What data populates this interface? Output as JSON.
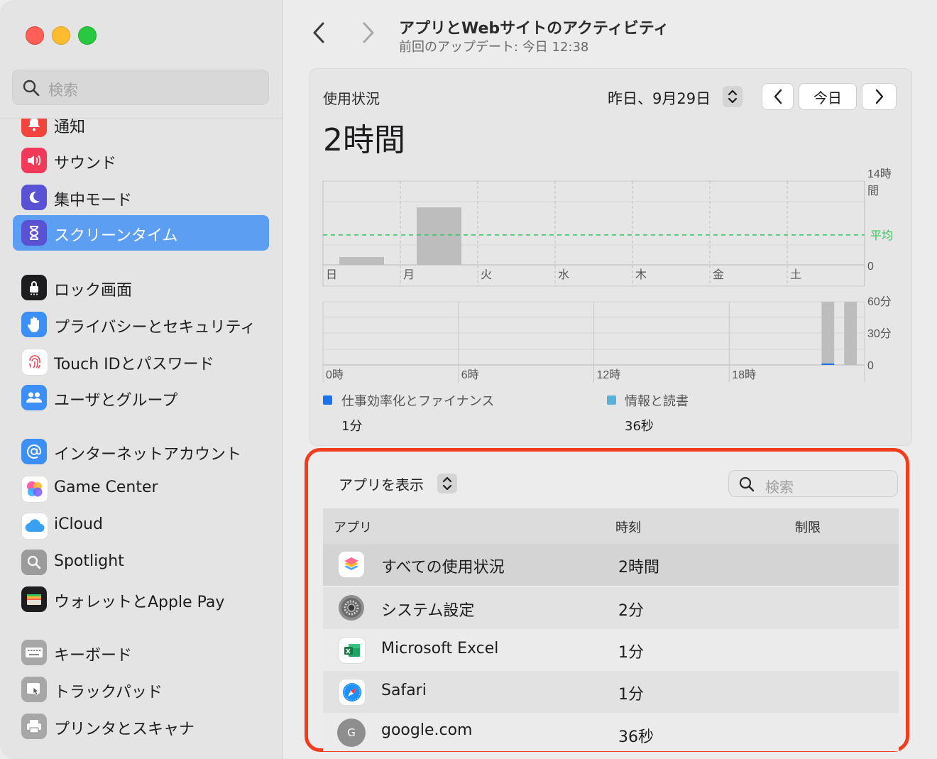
{
  "sidebar": {
    "search_placeholder": "検索",
    "items": [
      {
        "label": "通知",
        "icon": "bell-icon",
        "color": "#f2443d"
      },
      {
        "label": "サウンド",
        "icon": "speaker-icon",
        "color": "#f2395a"
      },
      {
        "label": "集中モード",
        "icon": "moon-icon",
        "color": "#5a52d4"
      },
      {
        "label": "スクリーンタイム",
        "icon": "hourglass-icon",
        "color": "#5a52d4",
        "selected": true
      },
      {
        "label": "ロック画面",
        "icon": "lock-icon",
        "color": "#1d1d1f"
      },
      {
        "label": "プライバシーとセキュリティ",
        "icon": "hand-icon",
        "color": "#3b8ff5"
      },
      {
        "label": "Touch IDとパスワード",
        "icon": "fingerprint-icon",
        "color": "#ffffff"
      },
      {
        "label": "ユーザとグループ",
        "icon": "users-icon",
        "color": "#3b8ff5"
      },
      {
        "label": "インターネットアカウント",
        "icon": "at-icon",
        "color": "#3b8ff5"
      },
      {
        "label": "Game Center",
        "icon": "game-center-icon",
        "color": "#ffffff"
      },
      {
        "label": "iCloud",
        "icon": "cloud-icon",
        "color": "#ffffff"
      },
      {
        "label": "Spotlight",
        "icon": "spotlight-icon",
        "color": "#9b9b9b"
      },
      {
        "label": "ウォレットとApple Pay",
        "icon": "wallet-icon",
        "color": "#1d1d1f"
      },
      {
        "label": "キーボード",
        "icon": "keyboard-icon",
        "color": "#a7a7a7"
      },
      {
        "label": "トラックパッド",
        "icon": "trackpad-icon",
        "color": "#a7a7a7"
      },
      {
        "label": "プリンタとスキャナ",
        "icon": "printer-icon",
        "color": "#a7a7a7"
      }
    ]
  },
  "header": {
    "title": "アプリとWebサイトのアクティビティ",
    "subtitle": "前回のアップデート: 今日 12:38"
  },
  "usage": {
    "label": "使用状況",
    "total": "2時間",
    "date": "昨日、9月29日",
    "today_button": "今日"
  },
  "chart_data": [
    {
      "type": "bar",
      "categories": [
        "日",
        "月",
        "火",
        "水",
        "木",
        "金",
        "土"
      ],
      "values": [
        1.3,
        9.6,
        0,
        0,
        0,
        0,
        0
      ],
      "average": 5.0,
      "average_label": "平均",
      "ylim": [
        0,
        14
      ],
      "y_max_label": "14時間",
      "y_min_label": "0",
      "colors": {
        "bar": "#bdbdbd",
        "average": "#34c759"
      }
    },
    {
      "type": "bar",
      "x_labels": [
        "0時",
        "6時",
        "12時",
        "18時"
      ],
      "hours": [
        22,
        23
      ],
      "values": [
        {
          "hour": 22,
          "total": 60,
          "productivity": 1
        },
        {
          "hour": 23,
          "total": 60,
          "productivity": 0
        }
      ],
      "ylim": [
        0,
        60
      ],
      "y_labels": [
        "60分",
        "30分",
        "0"
      ],
      "colors": {
        "bar": "#bdbdbd",
        "productivity": "#1a73e8"
      }
    }
  ],
  "legend": [
    {
      "name": "仕事効率化とファイナンス",
      "value": "1分",
      "color": "#1a73e8"
    },
    {
      "name": "情報と読書",
      "value": "36秒",
      "color": "#5ab0d6"
    }
  ],
  "apps": {
    "show_label": "アプリを表示",
    "search_placeholder": "検索",
    "columns": {
      "app": "アプリ",
      "time": "時刻",
      "limit": "制限"
    },
    "rows": [
      {
        "name": "すべての使用状況",
        "time": "2時間",
        "icon": "stack-icon"
      },
      {
        "name": "システム設定",
        "time": "2分",
        "icon": "system-settings-icon"
      },
      {
        "name": "Microsoft Excel",
        "time": "1分",
        "icon": "excel-icon"
      },
      {
        "name": "Safari",
        "time": "1分",
        "icon": "safari-icon"
      },
      {
        "name": "google.com",
        "time": "36秒",
        "icon": "g-icon",
        "icon_letter": "G"
      }
    ]
  }
}
